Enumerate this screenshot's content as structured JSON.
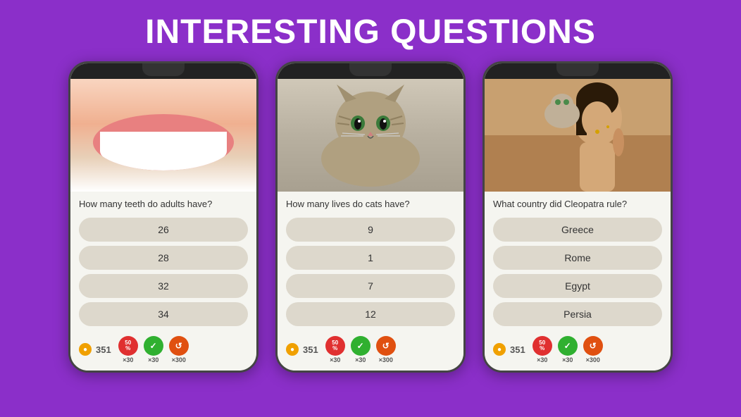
{
  "page": {
    "title": "INTERESTING QUESTIONS",
    "background_color": "#8B2FC9"
  },
  "phones": [
    {
      "id": "phone1",
      "question": "How many teeth do adults have?",
      "answers": [
        "26",
        "28",
        "32",
        "34"
      ],
      "coins": 351
    },
    {
      "id": "phone2",
      "question": "How many lives do cats have?",
      "answers": [
        "9",
        "1",
        "7",
        "12"
      ],
      "coins": 351
    },
    {
      "id": "phone3",
      "question": "What country did Cleopatra rule?",
      "answers": [
        "Greece",
        "Rome",
        "Egypt",
        "Persia"
      ],
      "coins": 351
    }
  ],
  "footer_badges": [
    {
      "label": "×30",
      "type": "red",
      "text": "50%"
    },
    {
      "label": "×30",
      "type": "green",
      "text": "✓"
    },
    {
      "label": "×300",
      "type": "orange",
      "text": "↺"
    }
  ]
}
